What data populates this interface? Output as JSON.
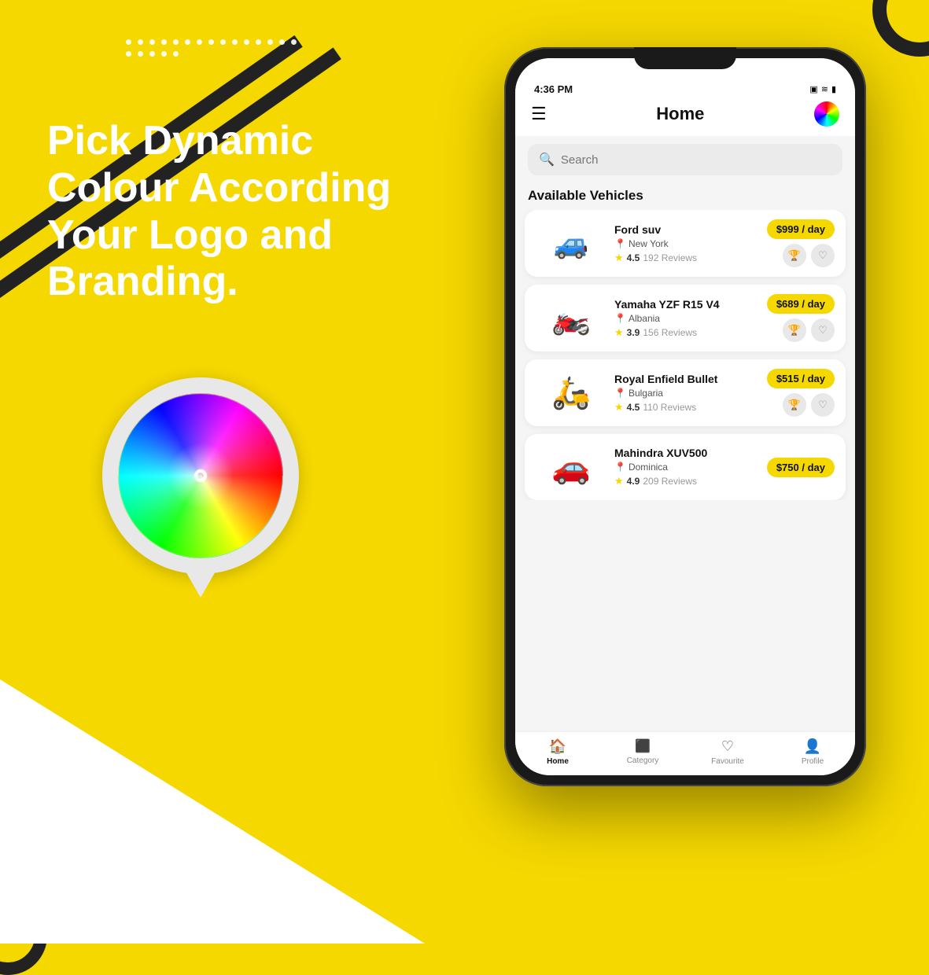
{
  "background": {
    "color": "#F5D800"
  },
  "left_panel": {
    "heading_line1": "Pick Dynamic",
    "heading_line2": "Colour According",
    "heading_line3": "Your Logo and Branding."
  },
  "app": {
    "status_bar": {
      "time": "4:36 PM",
      "icons": "▣ ≋ 🔋"
    },
    "header": {
      "menu_icon": "☰",
      "title": "Home",
      "color_wheel_icon": "🎨"
    },
    "search": {
      "placeholder": "Search"
    },
    "section_title": "Available Vehicles",
    "vehicles": [
      {
        "name": "Ford suv",
        "location": "New York",
        "rating": "4.5",
        "reviews": "192 Reviews",
        "price": "$999",
        "unit": "day",
        "emoji": "🚙"
      },
      {
        "name": "Yamaha YZF R15 V4",
        "location": "Albania",
        "rating": "3.9",
        "reviews": "156 Reviews",
        "price": "$689",
        "unit": "day",
        "emoji": "🏍️"
      },
      {
        "name": "Royal Enfield Bullet",
        "location": "Bulgaria",
        "rating": "4.5",
        "reviews": "110 Reviews",
        "price": "$515",
        "unit": "day",
        "emoji": "🛵"
      },
      {
        "name": "Mahindra XUV500",
        "location": "Dominica",
        "rating": "4.9",
        "reviews": "209 Reviews",
        "price": "$750",
        "unit": "day",
        "emoji": "🚗"
      }
    ],
    "bottom_nav": [
      {
        "label": "Home",
        "icon": "🏠",
        "active": true
      },
      {
        "label": "Category",
        "icon": "▲",
        "active": false
      },
      {
        "label": "Favourite",
        "icon": "♡",
        "active": false
      },
      {
        "label": "Profile",
        "icon": "👤",
        "active": false
      }
    ]
  }
}
